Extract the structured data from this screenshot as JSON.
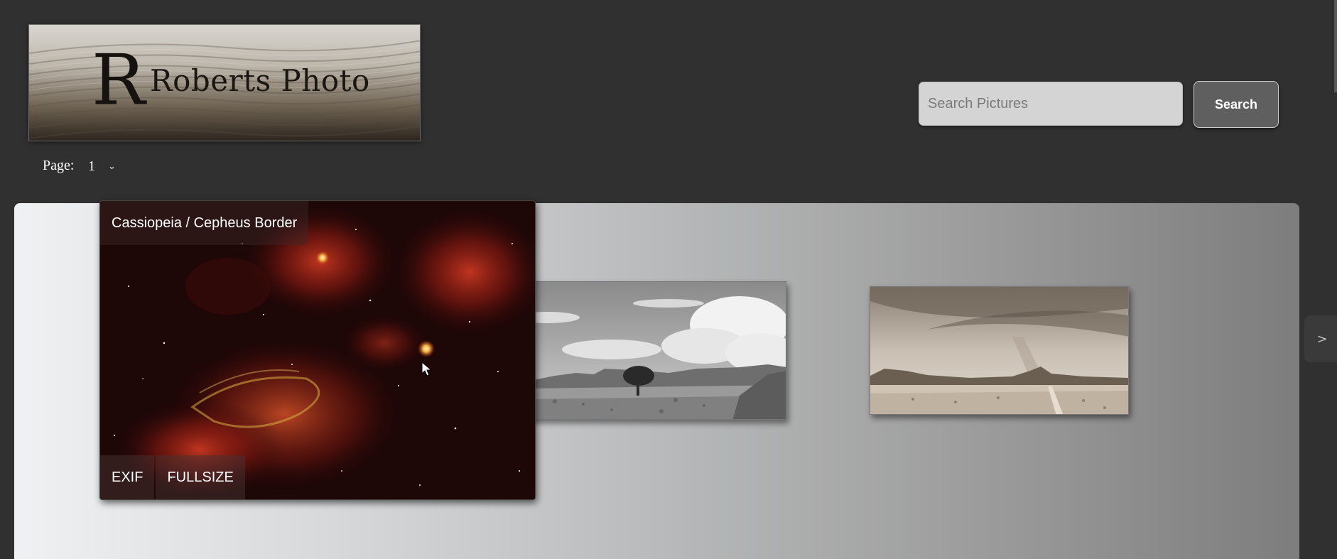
{
  "header": {
    "logo_initial": "R",
    "logo_text": "Roberts Photo"
  },
  "pagination": {
    "label": "Page:",
    "selected": "1"
  },
  "search": {
    "placeholder": "Search Pictures",
    "button_label": "Search"
  },
  "featured": {
    "title": "Cassiopeia / Cepheus Border",
    "actions": [
      "EXIF",
      "FULLSIZE"
    ]
  },
  "gallery": {
    "next_label": ">"
  },
  "colors": {
    "page_background": "#303030",
    "search_field": "#d4d4d4",
    "search_button": "#5f5f5f"
  },
  "icons": {
    "next": "chevron-right-icon",
    "page_select": "chevron-down-icon",
    "cursor": "mouse-cursor-icon"
  }
}
